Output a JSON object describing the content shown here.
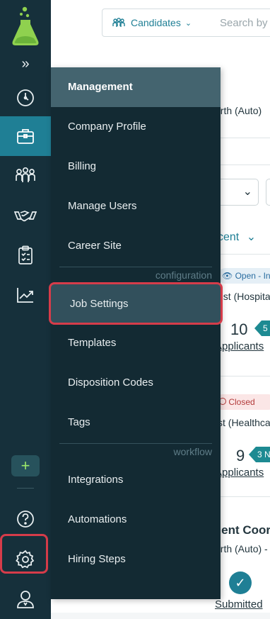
{
  "rail": {
    "items": [
      {
        "name": "dashboard",
        "icon": "gauge-icon"
      },
      {
        "name": "jobs",
        "icon": "briefcase-icon",
        "active": true
      },
      {
        "name": "candidates",
        "icon": "people-icon"
      },
      {
        "name": "clients",
        "icon": "handshake-icon"
      },
      {
        "name": "tasks",
        "icon": "clipboard-icon"
      },
      {
        "name": "reports",
        "icon": "chart-icon"
      }
    ],
    "add_label": "+",
    "expand_label": "»"
  },
  "topbar": {
    "candidates_label": "Candidates",
    "search_placeholder": "Search by"
  },
  "background": {
    "location_1": "orth (Auto)",
    "sort_label": "cent",
    "open_badge": "Open - In",
    "job_1_subtitle": "est (Hospita",
    "job_1_count": "10",
    "job_1_tag": "5",
    "applicants_label": "Applicants",
    "closed_badge": "Closed",
    "job_2_subtitle": "st (Healthca",
    "job_2_count": "9",
    "job_2_tag": "3 N",
    "job_3_title": "ment Coor",
    "job_3_subtitle": "orth (Auto) -",
    "submitted_label": "Submitted"
  },
  "menu": {
    "header": "Management",
    "management_items": [
      "Company Profile",
      "Billing",
      "Manage Users",
      "Career Site"
    ],
    "configuration_label": "configuration",
    "configuration_items": [
      "Job Settings",
      "Templates",
      "Disposition Codes",
      "Tags"
    ],
    "workflow_label": "workflow",
    "workflow_items": [
      "Integrations",
      "Automations",
      "Hiring Steps"
    ],
    "selected_item": "Job Settings"
  },
  "colors": {
    "rail_bg": "#16303b",
    "rail_active": "#1f7f95",
    "menu_bg": "#132a33",
    "menu_header": "#44646f",
    "highlight": "#d63c4a",
    "accent_green": "#8fd14f"
  }
}
